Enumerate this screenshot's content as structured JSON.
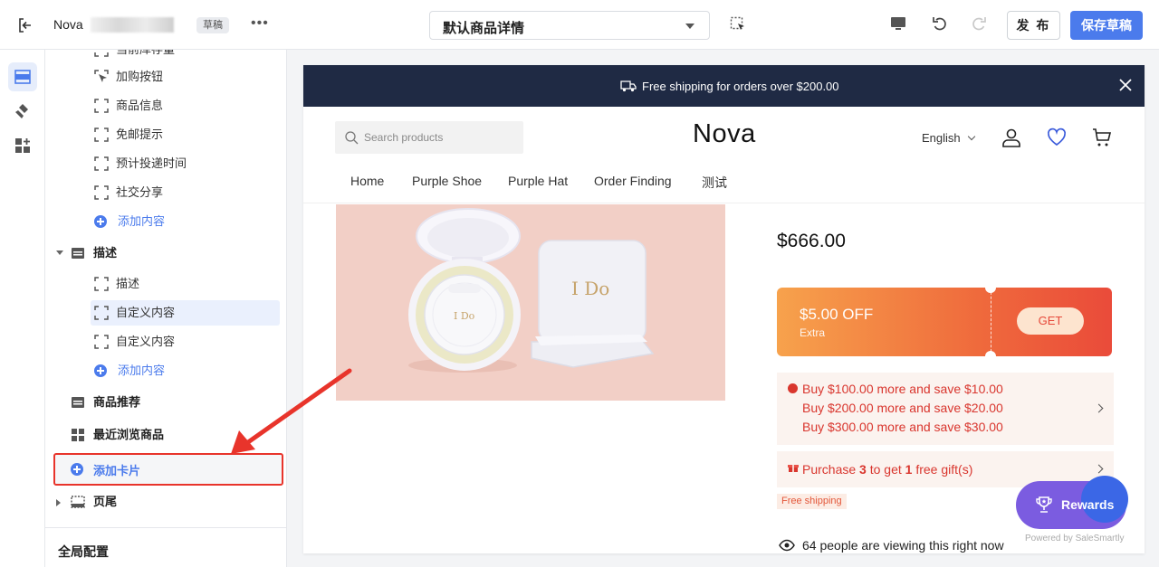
{
  "topbar": {
    "store_name": "Nova",
    "status_badge": "草稿",
    "more_label": "•••",
    "template_select": "默认商品详情",
    "publish_label": "发 布",
    "save_draft_label": "保存草稿"
  },
  "rail": {
    "icons": [
      "layout-icon",
      "brush-icon",
      "apps-icon"
    ]
  },
  "sidebar": {
    "top_partial": "当前库存量",
    "items": [
      {
        "label": "加购按钮",
        "icon": "bracket-icon"
      },
      {
        "label": "商品信息",
        "icon": "bracket-icon"
      },
      {
        "label": "免邮提示",
        "icon": "bracket-icon"
      },
      {
        "label": "预计投递时间",
        "icon": "bracket-icon"
      },
      {
        "label": "社交分享",
        "icon": "bracket-icon"
      },
      {
        "label": "添加内容",
        "icon": "plus-icon"
      }
    ],
    "group_desc": "描述",
    "desc_items": [
      {
        "label": "描述"
      },
      {
        "label": "自定义内容"
      },
      {
        "label": "自定义内容"
      },
      {
        "label": "添加内容"
      }
    ],
    "recommend": "商品推荐",
    "recent": "最近浏览商品",
    "add_card": "添加卡片",
    "footer": "页尾",
    "global_config": "全局配置"
  },
  "preview": {
    "announcement": "Free shipping for orders over $200.00",
    "search_placeholder": "Search products",
    "logo": "Nova",
    "language": "English",
    "nav": [
      "Home",
      "Purple Shoe",
      "Purple Hat",
      "Order Finding",
      "测试"
    ],
    "product_image_text": "I Do",
    "price": "$666.00",
    "coupon": {
      "amount": "$5.00 OFF",
      "note": "Extra",
      "button": "GET"
    },
    "promotions": [
      "Buy $100.00 more and save $10.00",
      "Buy $200.00 more and save $20.00",
      "Buy $300.00 more and save $30.00"
    ],
    "gift": {
      "prefix": "Purchase",
      "qty": "3",
      "middle": "to get",
      "count": "1",
      "suffix": "free gift(s)"
    },
    "free_shipping": "Free shipping",
    "viewing": "64 people are viewing this right now"
  },
  "rewards": {
    "label": "Rewards",
    "powered": "Powered by SaleSmartly"
  },
  "colors": {
    "accent": "#4b7bec",
    "announcement_bg": "#1f2a44",
    "annotation": "#e8342b",
    "promo_red": "#d9362e"
  }
}
